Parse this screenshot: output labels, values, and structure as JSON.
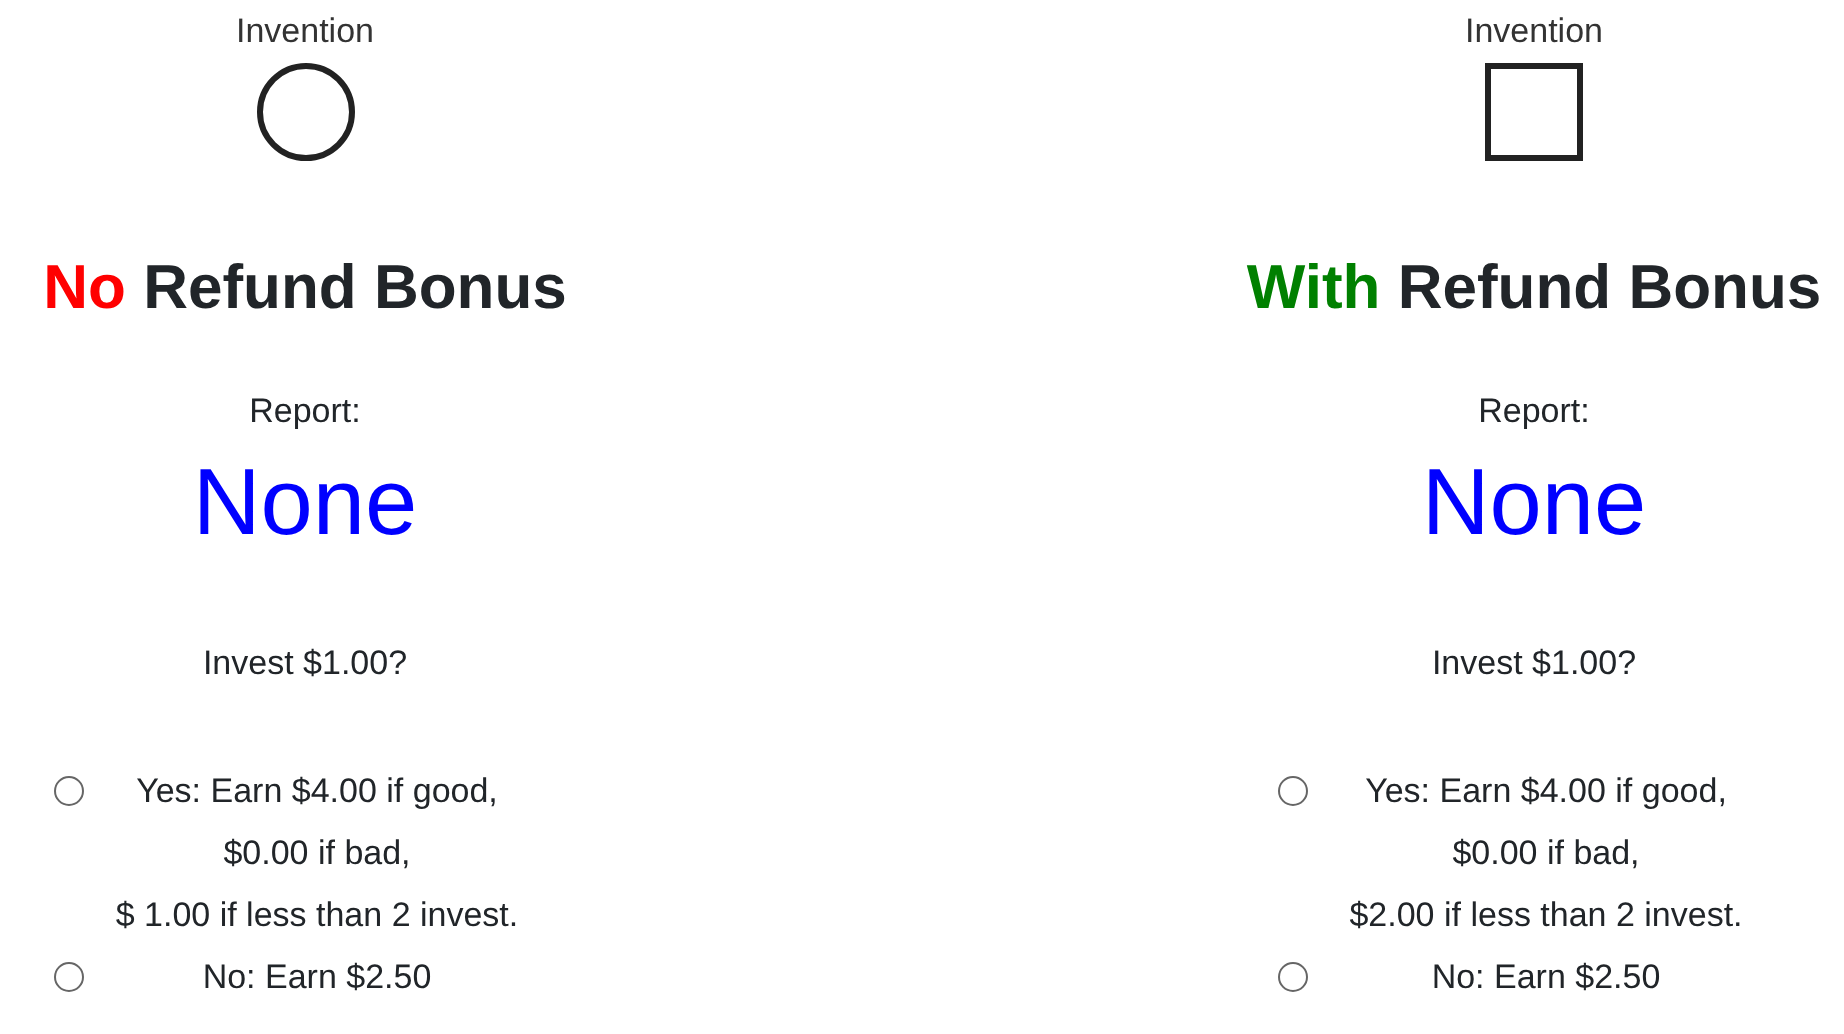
{
  "panels": [
    {
      "symbol_label": "Invention",
      "symbol": {
        "kind": "circle"
      },
      "heading": {
        "prefix": "No",
        "color": "#ff0000",
        "rest": "Refund Bonus"
      },
      "report_label": "Report:",
      "report_value": "None",
      "question": "Invest $1.00?",
      "options": [
        {
          "lines": [
            "Yes: Earn $4.00 if good,",
            "$0.00 if bad,",
            "$ 1.00 if less than 2 invest."
          ],
          "selected": false
        },
        {
          "lines": [
            "No: Earn $2.50"
          ],
          "selected": false
        }
      ]
    },
    {
      "symbol_label": "Invention",
      "symbol": {
        "kind": "square"
      },
      "heading": {
        "prefix": "With",
        "color": "#008000",
        "rest": "Refund Bonus"
      },
      "report_label": "Report:",
      "report_value": "None",
      "question": "Invest $1.00?",
      "options": [
        {
          "lines": [
            "Yes: Earn $4.00 if good,",
            "$0.00 if bad,",
            "$2.00 if less than 2 invest."
          ],
          "selected": false
        },
        {
          "lines": [
            "No: Earn $2.50"
          ],
          "selected": false
        }
      ]
    }
  ]
}
